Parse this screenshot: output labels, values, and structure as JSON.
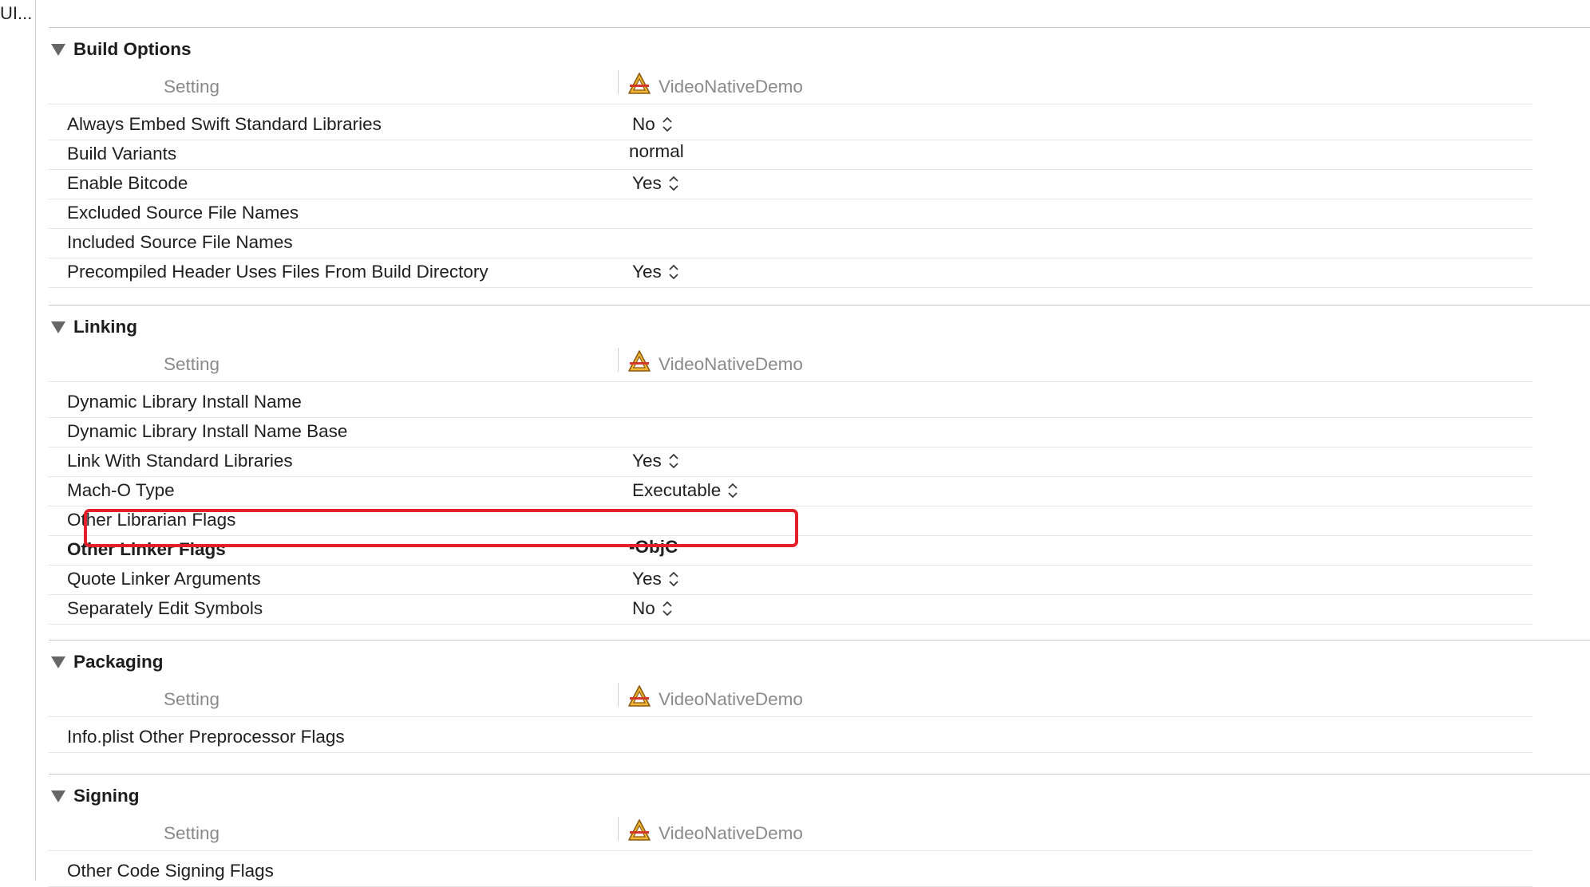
{
  "sidebar": {
    "truncated_label": "UI..."
  },
  "column_header": {
    "setting": "Setting",
    "target": "VideoNativeDemo",
    "target_icon": "xcode-app-icon"
  },
  "sections": [
    {
      "title": "Build Options",
      "rows": [
        {
          "name": "Always Embed Swift Standard Libraries",
          "value": "No",
          "stepper": true
        },
        {
          "name": "Build Variants",
          "value": "normal",
          "stepper": false
        },
        {
          "name": "Enable Bitcode",
          "value": "Yes",
          "stepper": true
        },
        {
          "name": "Excluded Source File Names",
          "value": "",
          "stepper": false
        },
        {
          "name": "Included Source File Names",
          "value": "",
          "stepper": false
        },
        {
          "name": "Precompiled Header Uses Files From Build Directory",
          "value": "Yes",
          "stepper": true
        }
      ]
    },
    {
      "title": "Linking",
      "rows": [
        {
          "name": "Dynamic Library Install Name",
          "value": "",
          "stepper": false
        },
        {
          "name": "Dynamic Library Install Name Base",
          "value": "",
          "stepper": false
        },
        {
          "name": "Link With Standard Libraries",
          "value": "Yes",
          "stepper": true
        },
        {
          "name": "Mach-O Type",
          "value": "Executable",
          "stepper": true
        },
        {
          "name": "Other Librarian Flags",
          "value": "",
          "stepper": false
        },
        {
          "name": "Other Linker Flags",
          "value": "-ObjC",
          "stepper": false,
          "bold": true
        },
        {
          "name": "Quote Linker Arguments",
          "value": "Yes",
          "stepper": true
        },
        {
          "name": "Separately Edit Symbols",
          "value": "No",
          "stepper": true
        }
      ]
    },
    {
      "title": "Packaging",
      "rows": [
        {
          "name": "Info.plist Other Preprocessor Flags",
          "value": "",
          "stepper": false
        }
      ]
    },
    {
      "title": "Signing",
      "rows": [
        {
          "name": "Other Code Signing Flags",
          "value": "",
          "stepper": false
        }
      ]
    }
  ],
  "highlight": {
    "color": "#e3202a",
    "target_row": "Other Linker Flags"
  }
}
